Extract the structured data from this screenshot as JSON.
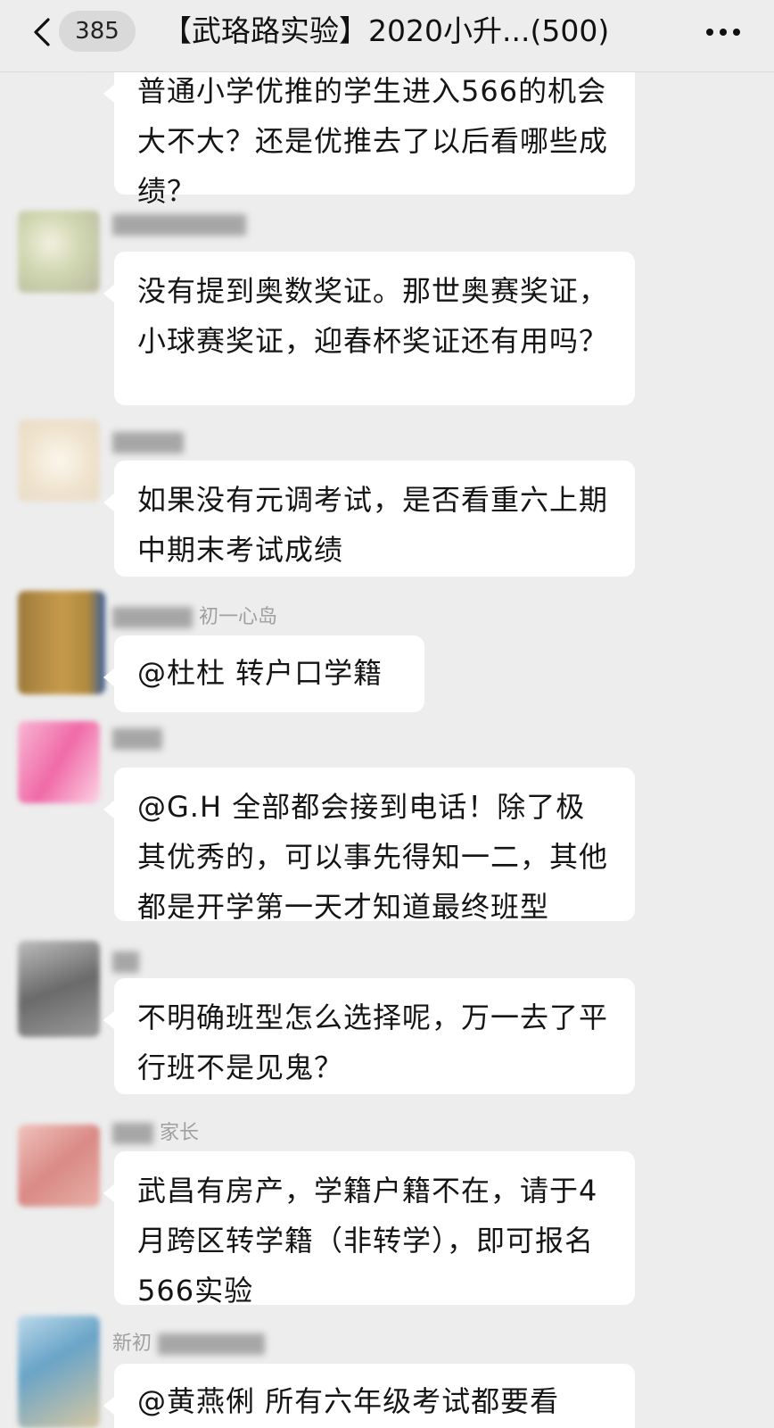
{
  "nav": {
    "unread_count": "385",
    "title": "【武珞路实验】2020小升...(500)"
  },
  "messages": [
    {
      "sender": "",
      "avatar_color": "#2b8fb8",
      "text": "普通小学优推的学生进入566的机会大不大？还是优推去了以后看哪些成绩？"
    },
    {
      "sender": "",
      "avatar_color": "#b9b9a0",
      "text": "没有提到奥数奖证。那世奥赛奖证，小球赛奖证，迎春杯奖证还有用吗？"
    },
    {
      "sender": "",
      "avatar_color": "#e8dcc8",
      "text": "如果没有元调考试，是否看重六上期中期末考试成绩"
    },
    {
      "sender": "初一心岛",
      "avatar_color": "#b08a3c",
      "text": "@杜杜 转户口学籍"
    },
    {
      "sender": "",
      "avatar_color": "#f06aa8",
      "text": "@G.H 全部都会接到电话！除了极其优秀的，可以事先得知一二，其他都是开学第一天才知道最终班型"
    },
    {
      "sender": "",
      "avatar_color": "#6a6a6a",
      "text": "不明确班型怎么选择呢，万一去了平行班不是见鬼？"
    },
    {
      "sender": "家长",
      "avatar_color": "#d98a86",
      "text": "武昌有房产，学籍户籍不在，请于4月跨区转学籍（非转学），即可报名566实验"
    },
    {
      "sender": "新初",
      "avatar_color": "#6aa4c8",
      "text": "@黄燕俐 所有六年级考试都要看"
    }
  ]
}
